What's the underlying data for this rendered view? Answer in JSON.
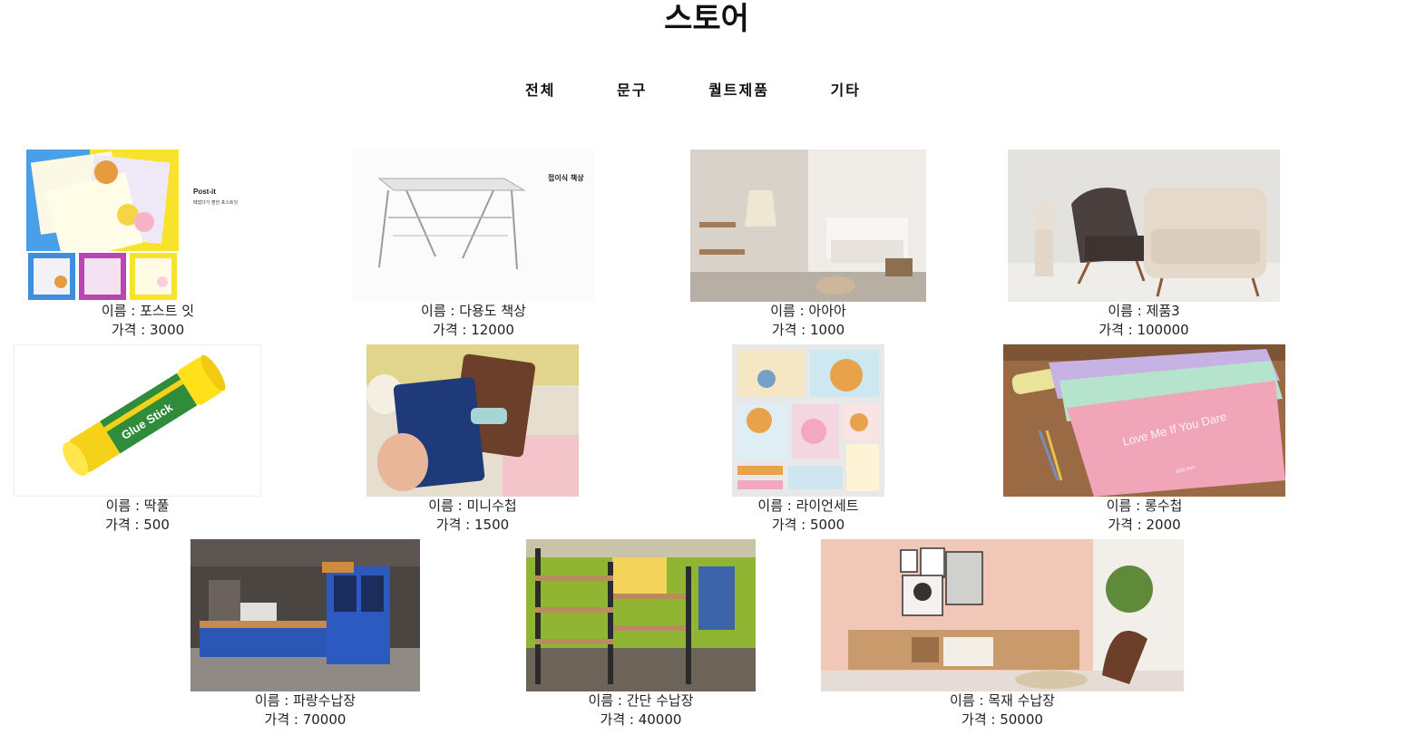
{
  "page": {
    "title": "스토어"
  },
  "nav": {
    "items": [
      "전체",
      "문구",
      "퀄트제품",
      "기타"
    ]
  },
  "products": [
    {
      "image_text": [
        "Post-it",
        "떼었다가 편한 포스트잇"
      ],
      "name_line": "이름 : 포스트 잇",
      "price_line": "가격 : 3000"
    },
    {
      "image_text": [
        "접이식 책상"
      ],
      "name_line": "이름 : 다용도 책상",
      "price_line": "가격 : 12000"
    },
    {
      "image_text": [],
      "name_line": "이름 : 아아아",
      "price_line": "가격 : 1000"
    },
    {
      "image_text": [],
      "name_line": "이름 : 제품3",
      "price_line": "가격 : 100000"
    },
    {
      "image_text": [
        "Glue Stick"
      ],
      "name_line": "이름 : 딱풀",
      "price_line": "가격 : 500"
    },
    {
      "image_text": [],
      "name_line": "이름 : 미니수첩",
      "price_line": "가격 : 1500"
    },
    {
      "image_text": [],
      "name_line": "이름 : 라이언세트",
      "price_line": "가격 : 5000"
    },
    {
      "image_text": [
        "Love Me If You Dare",
        "600 mm"
      ],
      "name_line": "이름 : 롱수첩",
      "price_line": "가격 : 2000"
    },
    {
      "image_text": [],
      "name_line": "이름 : 파랑수납장",
      "price_line": "가격 : 70000"
    },
    {
      "image_text": [],
      "name_line": "이름 : 간단 수납장",
      "price_line": "가격 : 40000"
    },
    {
      "image_text": [],
      "name_line": "이름 : 목재 수납장",
      "price_line": "가격 : 50000"
    }
  ]
}
